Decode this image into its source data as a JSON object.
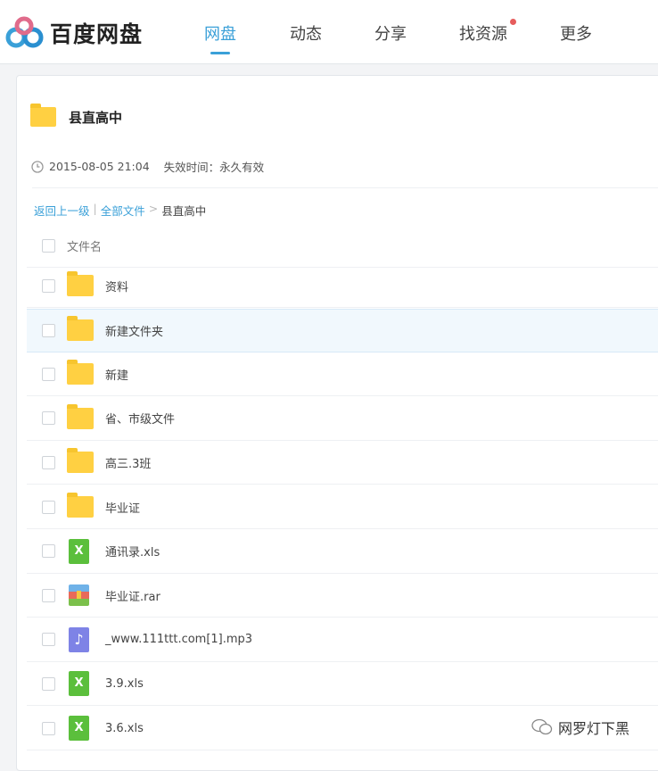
{
  "header": {
    "logo": "百度网盘",
    "nav": [
      {
        "label": "网盘",
        "active": true
      },
      {
        "label": "动态"
      },
      {
        "label": "分享"
      },
      {
        "label": "找资源",
        "badge": true
      },
      {
        "label": "更多"
      }
    ]
  },
  "folder": {
    "title": "县直高中",
    "date": "2015-08-05 21:04",
    "expiry": "失效时间：永久有效"
  },
  "breadcrumb": {
    "back": "返回上一级",
    "divider": "|",
    "all": "全部文件",
    "arrow": ">",
    "current": "县直高中"
  },
  "list": {
    "header": "文件名",
    "items": [
      {
        "name": "资料",
        "type": "folder"
      },
      {
        "name": "新建文件夹",
        "type": "folder"
      },
      {
        "name": "新建",
        "type": "folder"
      },
      {
        "name": "省、市级文件",
        "type": "folder"
      },
      {
        "name": "高三.3班",
        "type": "folder"
      },
      {
        "name": "毕业证",
        "type": "folder"
      },
      {
        "name": "通讯录.xls",
        "type": "xls"
      },
      {
        "name": "毕业证.rar",
        "type": "rar"
      },
      {
        "name": "_www.111ttt.com[1].mp3",
        "type": "mp3"
      },
      {
        "name": "3.9.xls",
        "type": "xls"
      },
      {
        "name": "3.6.xls",
        "type": "xls"
      }
    ]
  },
  "watermark": "网罗灯下黑",
  "colors": {
    "accent": "#3aa0d8",
    "folder": "#ffd042",
    "xls": "#5bbf3c",
    "mp3": "#7e83e6"
  }
}
